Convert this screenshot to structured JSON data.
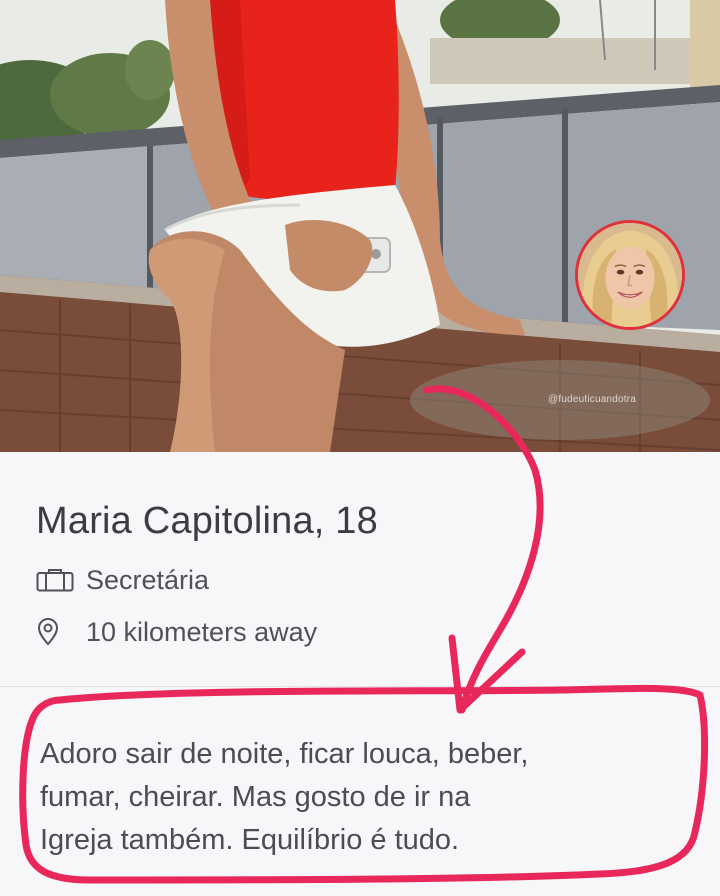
{
  "profile": {
    "name": "Maria Capitolina,",
    "age": "18",
    "job": "Secretária",
    "distance": "10 kilometers away",
    "bio": "Adoro sair de noite, ficar louca, beber,\nfumar, cheirar. Mas gosto de ir na\nIgreja também. Equilíbrio é tudo."
  },
  "photo": {
    "watermark": "@fudeuticuandotra"
  },
  "icons": {
    "job": "briefcase-icon",
    "distance": "location-pin-icon"
  },
  "colors": {
    "annotation": "#e8285a",
    "avatar_ring": "#e0303a",
    "shirt": "#e8231c",
    "text": "#3b3d40",
    "card_bg": "#f7f7f9"
  }
}
